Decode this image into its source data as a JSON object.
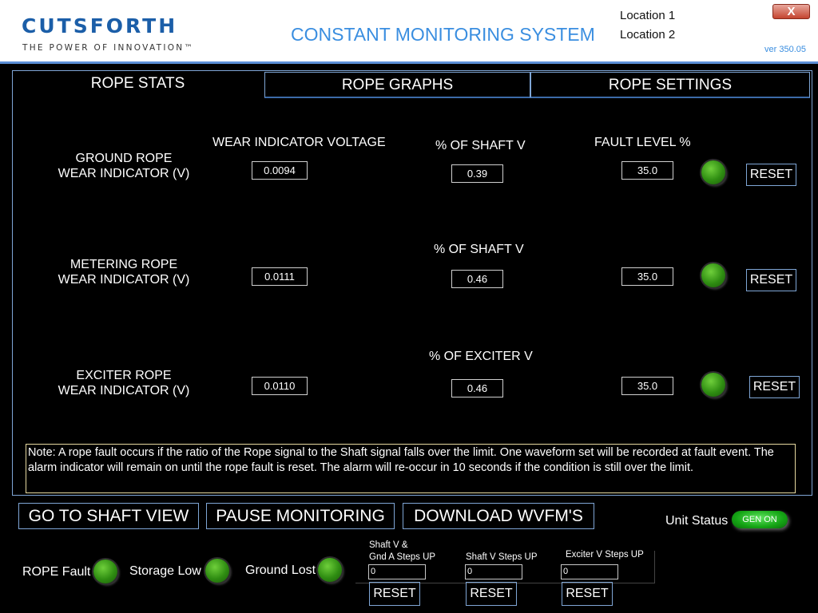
{
  "header": {
    "logo_text": "CUTSFORTH",
    "logo_tagline": "THE POWER OF INNOVATION™",
    "title": "CONSTANT MONITORING SYSTEM",
    "location1": "Location 1",
    "location2": "Location 2",
    "version": "ver 350.05",
    "close_label": "X"
  },
  "tabs": [
    {
      "label": "ROPE STATS",
      "active": true
    },
    {
      "label": "ROPE GRAPHS",
      "active": false
    },
    {
      "label": "ROPE SETTINGS",
      "active": false
    }
  ],
  "columns": {
    "wear_voltage": "WEAR INDICATOR VOLTAGE",
    "fault_level": "FAULT LEVEL %"
  },
  "rows": [
    {
      "label_line1": "GROUND ROPE",
      "label_line2": "WEAR INDICATOR (V)",
      "voltage": "0.0094",
      "pct_label": "% OF SHAFT V",
      "pct_value": "0.39",
      "fault_level": "35.0",
      "reset_label": "RESET"
    },
    {
      "label_line1": "METERING ROPE",
      "label_line2": "WEAR INDICATOR (V)",
      "voltage": "0.0111",
      "pct_label": "% OF SHAFT V",
      "pct_value": "0.46",
      "fault_level": "35.0",
      "reset_label": "RESET"
    },
    {
      "label_line1": "EXCITER ROPE",
      "label_line2": "WEAR INDICATOR (V)",
      "voltage": "0.0110",
      "pct_label": "% OF EXCITER V",
      "pct_value": "0.46",
      "fault_level": "35.0",
      "reset_label": "RESET"
    }
  ],
  "note": "Note:  A rope fault occurs if the ratio of the Rope signal to the Shaft signal falls over the limit. One waveform set will be recorded at fault event.  The alarm indicator will remain on until the rope fault is reset.  The alarm will re-occur in 10 seconds if the condition is still over the limit.",
  "actions": {
    "shaft_view": "GO TO SHAFT VIEW",
    "pause": "PAUSE MONITORING",
    "download": "DOWNLOAD WVFM'S"
  },
  "unit_status": {
    "label": "Unit Status",
    "value": "GEN ON"
  },
  "indicators": [
    {
      "label": "ROPE Fault",
      "color": "#2f8d12"
    },
    {
      "label": "Storage Low",
      "color": "#2f8d12"
    },
    {
      "label": "Ground Lost",
      "color": "#2f8d12"
    }
  ],
  "steps": [
    {
      "title_line1": "Shaft V &",
      "title_line2": "Gnd A Steps UP",
      "value": "0",
      "reset_label": "RESET"
    },
    {
      "title_line1": "",
      "title_line2": "Shaft V Steps UP",
      "value": "0",
      "reset_label": "RESET"
    },
    {
      "title_line1": "",
      "title_line2": "Exciter V Steps UP",
      "value": "0",
      "reset_label": "RESET"
    }
  ]
}
